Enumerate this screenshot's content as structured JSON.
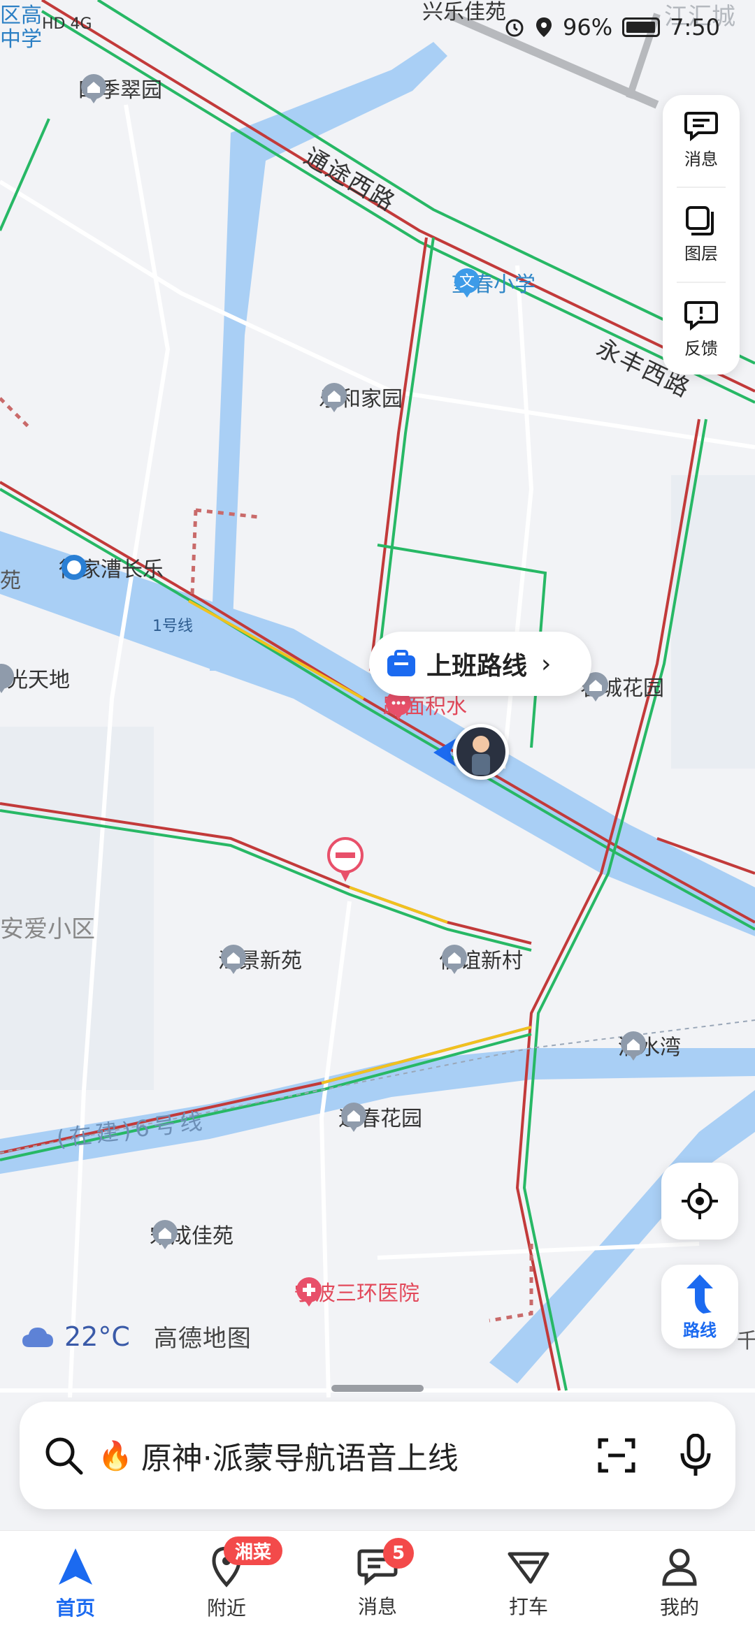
{
  "status_bar": {
    "carrier_label": "区高\n中学",
    "network": "HD 4G",
    "battery": "96%",
    "time": "7:50",
    "top_poi": "兴乐佳苑",
    "corner_label": "江汇城"
  },
  "map": {
    "pois": [
      {
        "name": "四季翠园"
      },
      {
        "name": "望春小学"
      },
      {
        "name": "乐和家园"
      },
      {
        "name": "徐家漕长乐"
      },
      {
        "name": "阳光天地"
      },
      {
        "name": "春城花园"
      },
      {
        "name": "汇景新苑"
      },
      {
        "name": "信谊新村"
      },
      {
        "name": "清水湾"
      },
      {
        "name": "迎春花园"
      },
      {
        "name": "宋成佳苑"
      },
      {
        "name": "宁波三环医院"
      },
      {
        "name": "路面积水"
      }
    ],
    "roads": [
      {
        "name": "通途西路"
      },
      {
        "name": "永丰西路"
      }
    ],
    "area_labels": [
      "苑",
      "安爱小区",
      "千"
    ],
    "lines": [
      "1号线",
      "(在建)6号线"
    ]
  },
  "tools": {
    "messages_label": "消息",
    "layers_label": "图层",
    "feedback_label": "反馈"
  },
  "commute_bubble": {
    "label": "上班路线"
  },
  "route_button": {
    "label": "路线"
  },
  "weather": {
    "temp": "22°C",
    "brand": "高德地图"
  },
  "search": {
    "placeholder": "原神·派蒙导航语音上线"
  },
  "tabbar": {
    "tabs": [
      {
        "label": "首页",
        "active": true
      },
      {
        "label": "附近",
        "badge": "湘菜"
      },
      {
        "label": "消息",
        "badge": "5"
      },
      {
        "label": "打车"
      },
      {
        "label": "我的"
      }
    ]
  },
  "colors": {
    "accent": "#1b6af0",
    "water": "#a9cff5",
    "road_green": "#27b865",
    "road_red": "#c23a3a",
    "road_yellow": "#f0c21e"
  }
}
